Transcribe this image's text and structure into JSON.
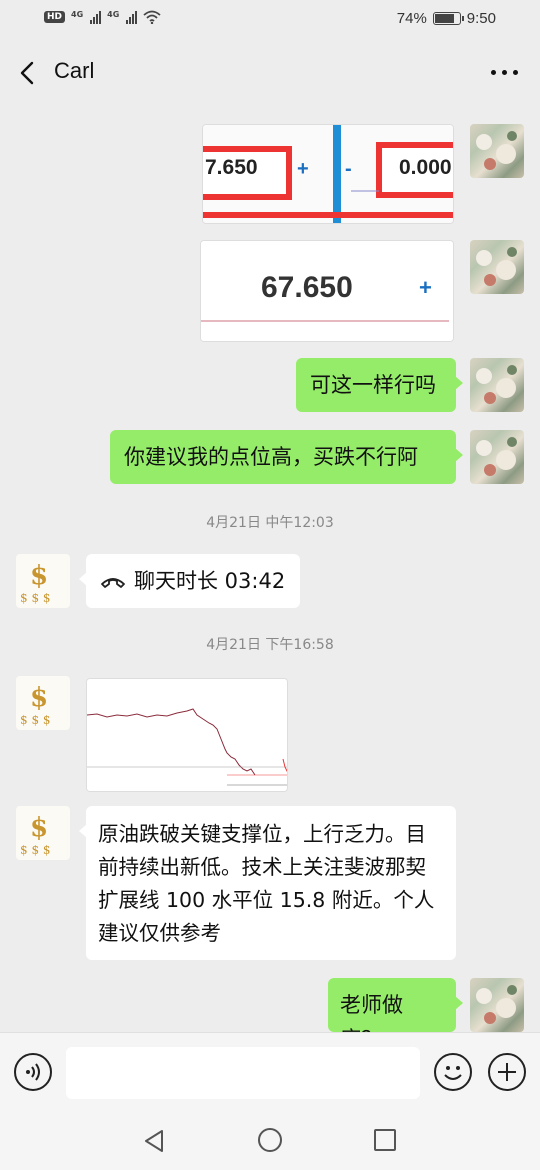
{
  "status_bar": {
    "hd": "HD",
    "net1": "4G",
    "net2": "4G",
    "battery_percent": "74%",
    "battery_level": 0.74,
    "time": "9:50"
  },
  "header": {
    "title": "Carl",
    "back_icon": "chevron-left-icon",
    "more_icon": "more-dots-icon"
  },
  "messages": {
    "img1": {
      "left_value": "7.650",
      "left_sign": "+",
      "right_sign": "-",
      "right_value": "0.000"
    },
    "img2": {
      "value": "67.650",
      "sign": "+"
    },
    "msg1": "可这一样行吗",
    "msg2": "你建议我的点位高，买跌不行阿",
    "time1": "4月21日 中午12:03",
    "call": "聊天时长 03:42",
    "time2": "4月21日 下午16:58",
    "msg3": "原油跌破关键支撑位，上行乏力。目前持续出新低。技术上关注斐波那契扩展线 100 水平位 15.8 附近。个人建议仅供参考",
    "msg4": "老师做底？"
  },
  "input": {
    "placeholder": "",
    "voice_icon": "voice-icon",
    "emoji_icon": "emoji-icon",
    "plus_icon": "plus-icon"
  },
  "nav": {
    "back": "nav-back-icon",
    "home": "nav-home-icon",
    "recent": "nav-recent-icon"
  },
  "colors": {
    "bubble_right": "#95ec69",
    "bubble_left": "#ffffff",
    "background": "#ededed"
  }
}
